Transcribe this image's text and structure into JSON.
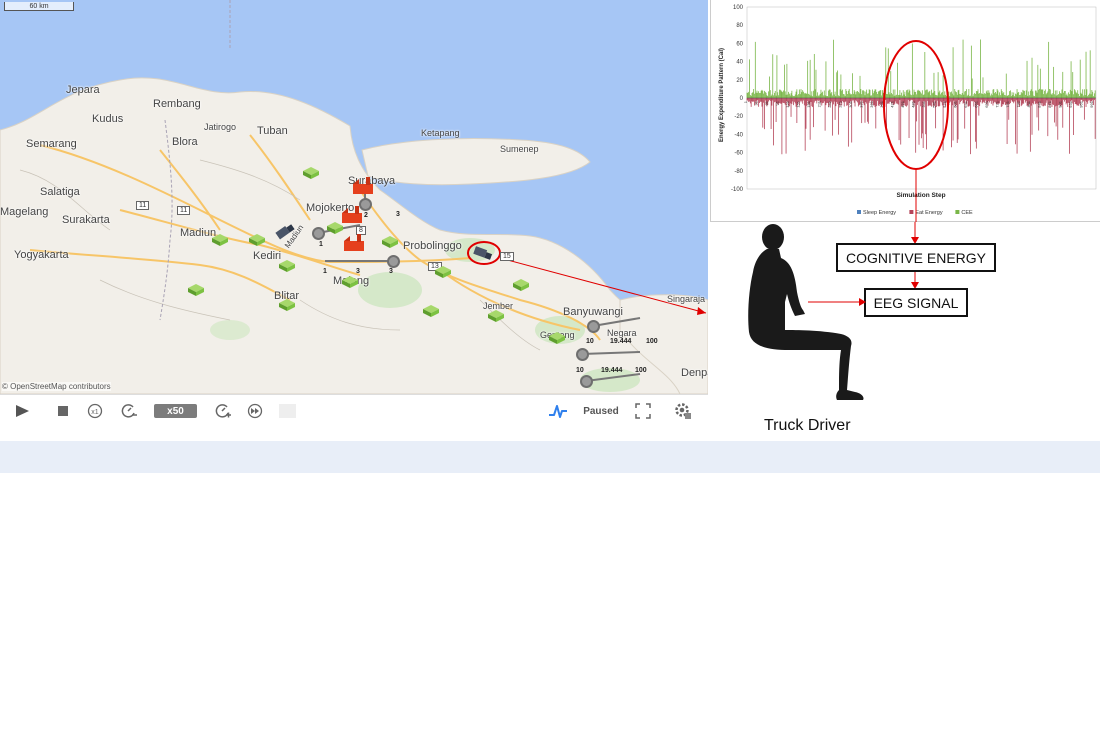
{
  "map": {
    "scale_label": "60 km",
    "attribution": "© OpenStreetMap contributors",
    "cities": {
      "jepara": "Jepara",
      "rembang": "Rembang",
      "kudus": "Kudus",
      "jatirogo": "Jatirogo",
      "tuban": "Tuban",
      "semarang": "Semarang",
      "blora": "Blora",
      "ketapang": "Ketapang",
      "sumenep": "Sumenep",
      "salatiga": "Salatiga",
      "magelang": "Magelang",
      "surakarta": "Surakarta",
      "madiun": "Madiun",
      "surabaya": "Surabaya",
      "mojokerto": "Mojokerto",
      "probolinggo": "Probolinggo",
      "yogyakarta": "Yogyakarta",
      "kediri": "Kediri",
      "malang": "Malang",
      "blitar": "Blitar",
      "jember": "Jember",
      "banyuwangi": "Banyuwangi",
      "singaraja": "Singaraja",
      "genteng": "Genteng",
      "negara": "Negara",
      "denpasar": "Denpasar"
    },
    "vehicle_labels": {
      "madiun_truck": "Madiun"
    },
    "route_numbers": {
      "r1": "3",
      "r2": "1",
      "r3": "1",
      "r4": "3",
      "r5": "3",
      "r6": "2",
      "r7": "10",
      "r8": "19.444",
      "r9": "100",
      "r10": "10",
      "r11": "19.444",
      "r12": "100"
    },
    "shields": {
      "s1": "11",
      "s2": "11",
      "s3": "13",
      "s4": "15",
      "s5": "8"
    }
  },
  "toolbar": {
    "speed_label": "x50",
    "status_label": "Paused"
  },
  "diagram": {
    "cognitive_energy_label": "COGNITIVE ENERGY",
    "eeg_signal_label": "EEG SIGNAL",
    "driver_caption": "Truck Driver"
  },
  "colors": {
    "sea": "#a6c6f5",
    "land": "#f2efe9",
    "depot_green": "#7dc242",
    "factory_red": "#e5401d",
    "highlight_red": "#e00000",
    "cee_green": "#7ab648",
    "eat_red": "#b5455a",
    "sleep_blue": "#4f81bd"
  },
  "chart_data": {
    "type": "bar",
    "title": "",
    "xlabel": "Simulation Step",
    "ylabel": "Energy Expenditure Pattern (Cal)",
    "ylim": [
      -100,
      100
    ],
    "yticks": [
      100,
      80,
      60,
      40,
      20,
      0,
      -20,
      -40,
      -60,
      -80,
      -100
    ],
    "x_range": [
      1,
      1000
    ],
    "legend_position": "bottom",
    "series": [
      {
        "name": "Sleep Energy",
        "color": "#4f81bd",
        "typical_range": [
          0,
          0
        ]
      },
      {
        "name": "Eat Energy",
        "color": "#b5455a",
        "typical_range": [
          -60,
          0
        ]
      },
      {
        "name": "CEE",
        "color": "#7ab648",
        "typical_range": [
          0,
          60
        ]
      }
    ]
  }
}
